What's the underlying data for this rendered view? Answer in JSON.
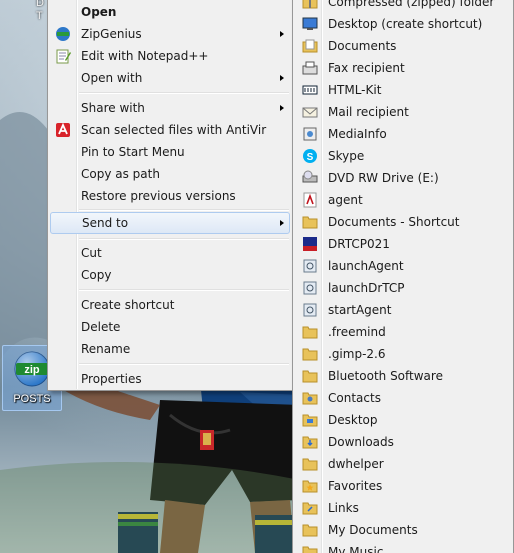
{
  "desktop": {
    "icon_label": "POSTS",
    "icon_badge": "zip",
    "fragments": [
      "D",
      "T"
    ]
  },
  "context_menu": {
    "items": [
      {
        "label": "Open",
        "bold": true,
        "icon": null
      },
      {
        "label": "ZipGenius",
        "icon": "zipgenius-icon",
        "submenu": true
      },
      {
        "label": "Edit with Notepad++",
        "icon": "notepadpp-icon"
      },
      {
        "label": "Open with",
        "icon": null,
        "submenu": true
      },
      {
        "label": "Share with",
        "icon": null,
        "submenu": true
      },
      {
        "label": "Scan selected files with AntiVir",
        "icon": "antivir-icon"
      },
      {
        "label": "Pin to Start Menu",
        "icon": null
      },
      {
        "label": "Copy as path",
        "icon": null
      },
      {
        "label": "Restore previous versions",
        "icon": null
      },
      {
        "label": "Send to",
        "icon": null,
        "submenu": true,
        "highlighted": true
      },
      {
        "label": "Cut",
        "icon": null
      },
      {
        "label": "Copy",
        "icon": null
      },
      {
        "label": "Create shortcut",
        "icon": null
      },
      {
        "label": "Delete",
        "icon": null
      },
      {
        "label": "Rename",
        "icon": null
      },
      {
        "label": "Properties",
        "icon": null
      }
    ]
  },
  "sendto_menu": {
    "items": [
      {
        "label": "Compressed (zipped) folder",
        "icon": "zip-folder-icon"
      },
      {
        "label": "Desktop (create shortcut)",
        "icon": "desktop-icon"
      },
      {
        "label": "Documents",
        "icon": "documents-library-icon"
      },
      {
        "label": "Fax recipient",
        "icon": "fax-icon"
      },
      {
        "label": "HTML-Kit",
        "icon": "htmlkit-icon"
      },
      {
        "label": "Mail recipient",
        "icon": "mail-icon"
      },
      {
        "label": "MediaInfo",
        "icon": "mediainfo-icon"
      },
      {
        "label": "Skype",
        "icon": "skype-icon"
      },
      {
        "label": "DVD RW Drive (E:)",
        "icon": "dvd-drive-icon"
      },
      {
        "label": "agent",
        "icon": "pdf-icon"
      },
      {
        "label": "Documents - Shortcut",
        "icon": "folder-icon"
      },
      {
        "label": "DRTCP021",
        "icon": "drtcp-icon"
      },
      {
        "label": "launchAgent",
        "icon": "script-icon"
      },
      {
        "label": "launchDrTCP",
        "icon": "script-icon"
      },
      {
        "label": "startAgent",
        "icon": "script-icon"
      },
      {
        "label": ".freemind",
        "icon": "folder-icon"
      },
      {
        "label": ".gimp-2.6",
        "icon": "folder-icon"
      },
      {
        "label": "Bluetooth Software",
        "icon": "folder-icon"
      },
      {
        "label": "Contacts",
        "icon": "contacts-folder-icon"
      },
      {
        "label": "Desktop",
        "icon": "desktop-folder-icon"
      },
      {
        "label": "Downloads",
        "icon": "downloads-folder-icon"
      },
      {
        "label": "dwhelper",
        "icon": "folder-icon"
      },
      {
        "label": "Favorites",
        "icon": "favorites-folder-icon"
      },
      {
        "label": "Links",
        "icon": "links-folder-icon"
      },
      {
        "label": "My Documents",
        "icon": "folder-icon"
      },
      {
        "label": "My Music",
        "icon": "folder-icon"
      }
    ]
  },
  "colors": {
    "menu_bg": "#f0f0f0",
    "menu_border": "#979797",
    "highlight_border": "#aecbef",
    "folder_yellow": "#e8c25a"
  }
}
